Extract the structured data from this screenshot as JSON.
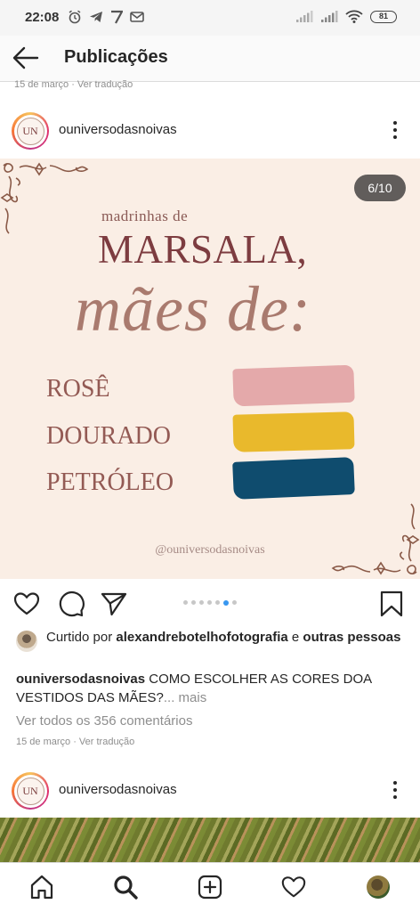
{
  "status_bar": {
    "time": "22:08",
    "battery": "81"
  },
  "header": {
    "title": "Publicações"
  },
  "prev_post": {
    "date_line": "15 de março · Ver tradução"
  },
  "post": {
    "username": "ouniversodasnoivas",
    "avatar_text": "UN",
    "counter": "6/10",
    "image_text": {
      "line1": "madrinhas de",
      "line2": "MARSALA,",
      "line3": "mães de:",
      "colors": [
        {
          "label": "ROSÊ",
          "swatch": "#e4a9aa"
        },
        {
          "label": "DOURADO",
          "swatch": "#e9b92c"
        },
        {
          "label": "PETRÓLEO",
          "swatch": "#0f4c6e"
        }
      ],
      "watermark": "@ouniversodasnoivas"
    },
    "carousel": {
      "total": 10,
      "active": 6
    },
    "likes": {
      "prefix": "Curtido por ",
      "user": "alexandrebotelhofotografia",
      "middle": " e ",
      "suffix": "outras pessoas"
    },
    "caption": {
      "user": "ouniversodasnoivas",
      "text": " COMO ESCOLHER AS CORES DOA VESTIDOS DAS MÃES?",
      "more": "... mais"
    },
    "comments_link": "Ver todos os 356 comentários",
    "date_line": "15 de março · Ver tradução"
  },
  "next_post": {
    "username": "ouniversodasnoivas",
    "avatar_text": "UN"
  },
  "icons": {
    "status": [
      "alarm-icon",
      "telegram-icon",
      "app-icon",
      "gmail-icon",
      "signal-icon",
      "wifi-icon",
      "battery-icon"
    ],
    "actions": [
      "heart-icon",
      "comment-icon",
      "share-icon",
      "bookmark-icon"
    ],
    "nav": [
      "home-icon",
      "search-icon",
      "add-post-icon",
      "activity-heart-icon",
      "profile-avatar"
    ]
  }
}
